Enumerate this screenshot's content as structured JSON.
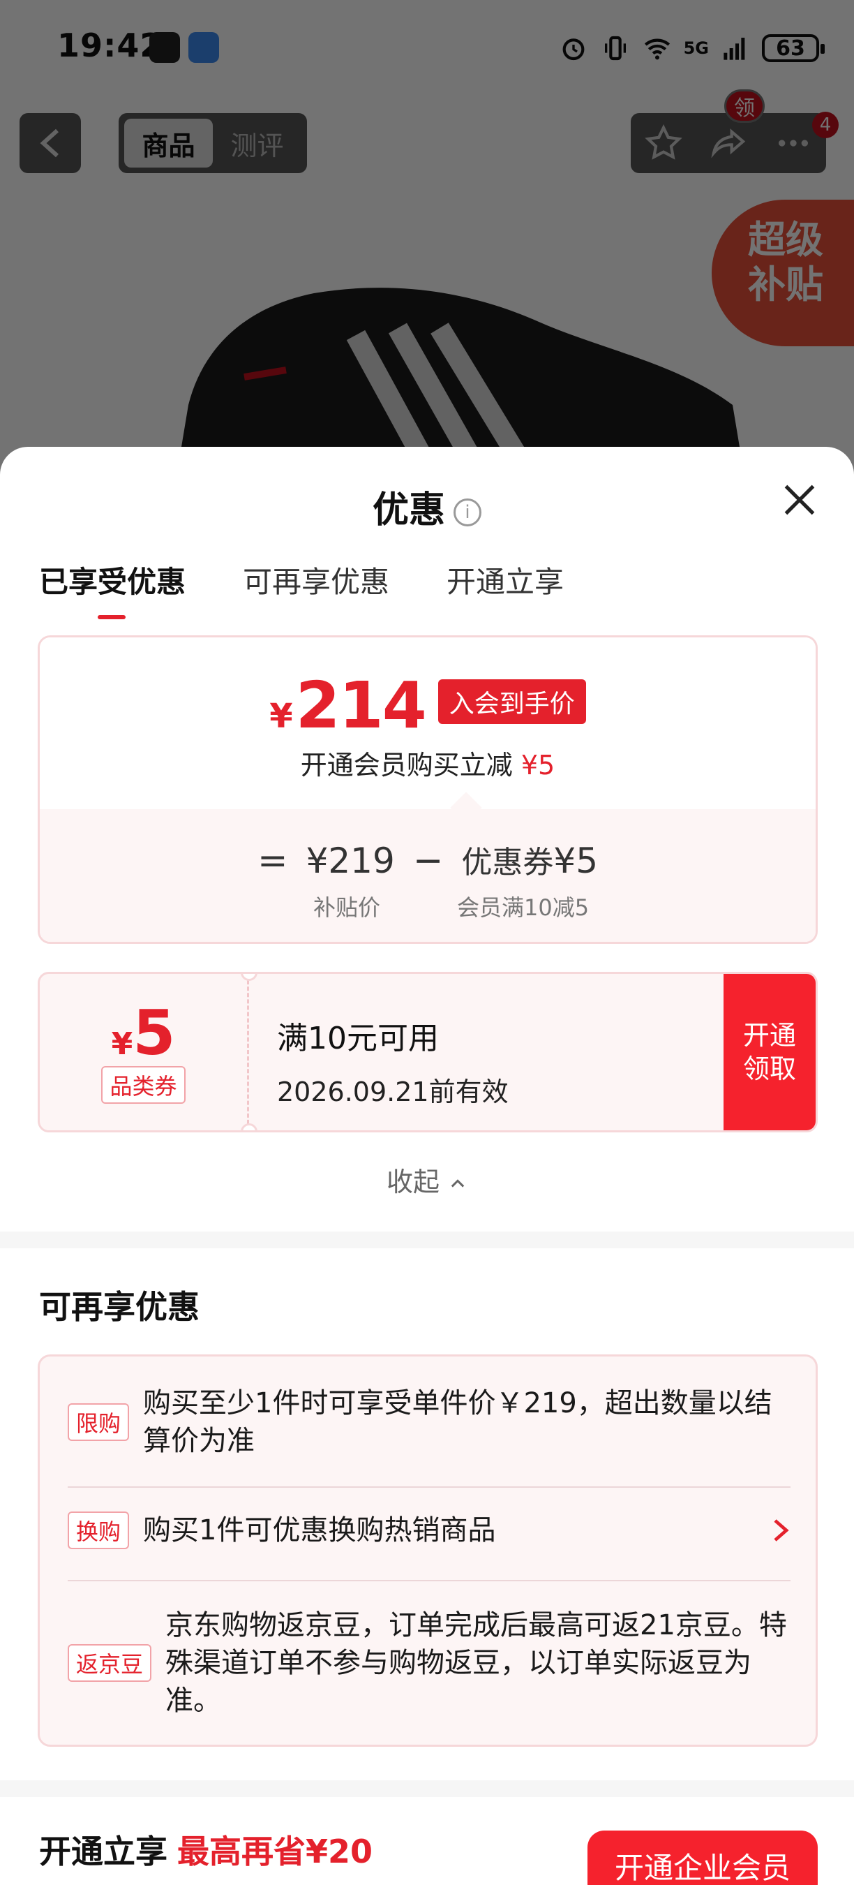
{
  "status_bar": {
    "time": "19:42",
    "network": "5G",
    "battery": "63"
  },
  "nav": {
    "tabs": [
      "商品",
      "测评"
    ],
    "active_tab": "商品",
    "ling_badge": "领",
    "more_count": "4"
  },
  "banner": {
    "line1": "超级",
    "line2": "补贴"
  },
  "sheet": {
    "title": "优惠",
    "tabs": [
      "已享受优惠",
      "可再享优惠",
      "开通立享"
    ],
    "active_tab": "已享受优惠"
  },
  "price_card": {
    "currency": "¥",
    "price": "214",
    "member_tag": "入会到手价",
    "sub_text": "开通会员购买立减",
    "sub_amount": "¥5",
    "equals": "=",
    "base_price": "¥219",
    "minus": "−",
    "coupon_label": "优惠券",
    "coupon_amount": "¥5",
    "base_caption": "补贴价",
    "coupon_caption": "会员满10减5"
  },
  "coupon": {
    "currency": "¥",
    "amount": "5",
    "type": "品类券",
    "condition": "满10元可用",
    "validity": "2026.09.21前有效",
    "button_line1": "开通",
    "button_line2": "领取"
  },
  "collapse_label": "收起",
  "more_section": {
    "title": "可再享优惠",
    "items": [
      {
        "tag": "限购",
        "text": "购买至少1件时可享受单件价￥219，超出数量以结算价为准"
      },
      {
        "tag": "换购",
        "text": "购买1件可优惠换购热销商品"
      },
      {
        "tag": "返京豆",
        "text": "京东购物返京豆，订单完成后最高可返21京豆。特殊渠道订单不参与购物返豆，以订单实际返豆为准。"
      }
    ]
  },
  "vip_section": {
    "title": "开通立享",
    "highlight": "最高再省¥20",
    "button": "开通企业会员"
  },
  "colors": {
    "accent": "#e4212c",
    "button_red": "#f5222d",
    "card_border": "#f6d7d9",
    "card_bg": "#fdf5f5"
  }
}
